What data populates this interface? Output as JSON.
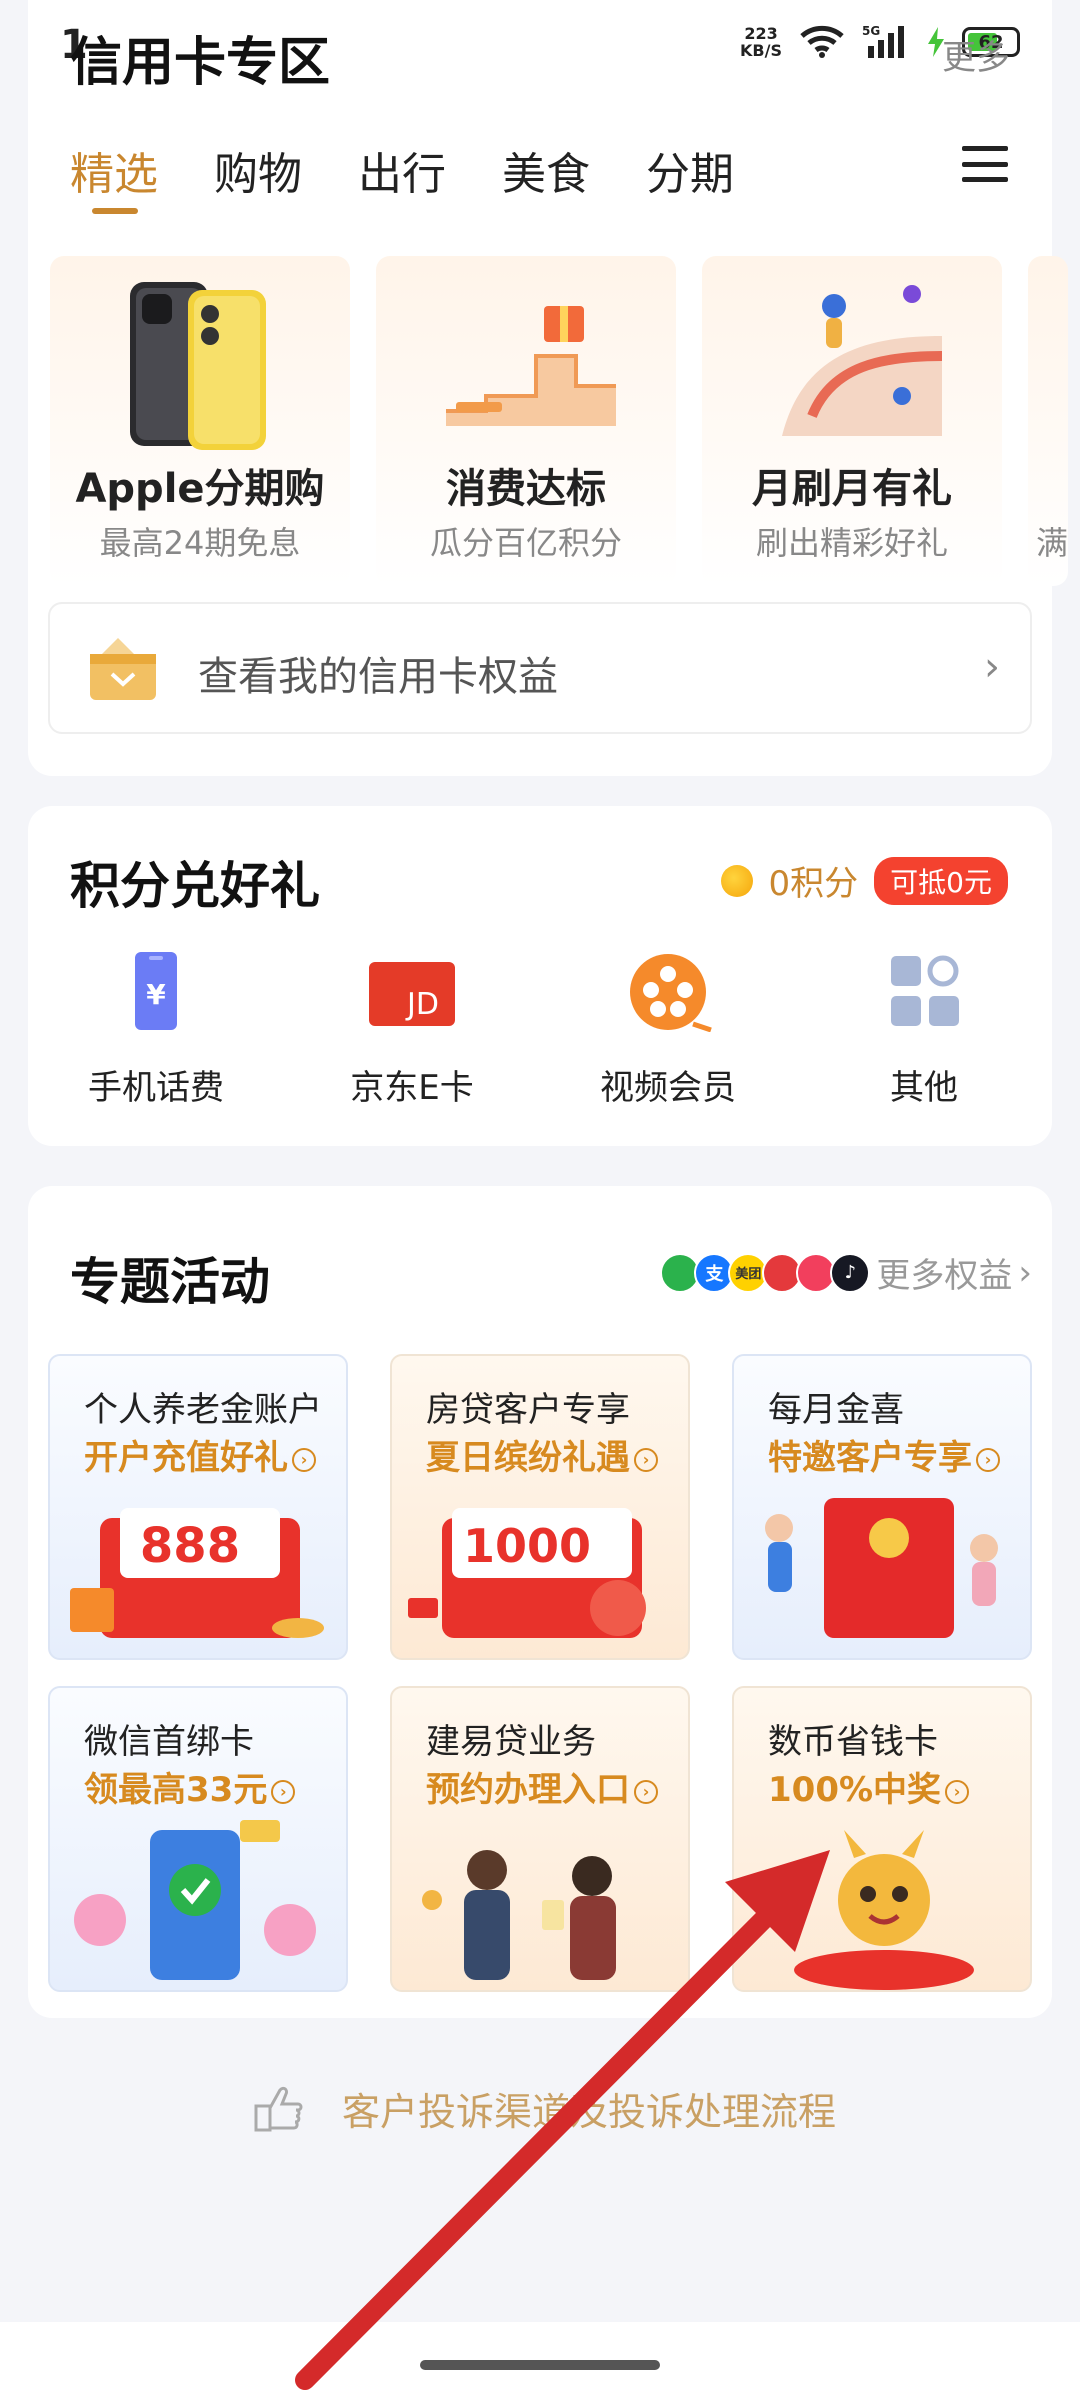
{
  "status_bar": {
    "time": "1",
    "net_speed_value": "223",
    "net_speed_unit": "KB/S",
    "signal_label": "5G",
    "battery": "62"
  },
  "header": {
    "title": "信用卡专区",
    "more": "更多"
  },
  "tabs": [
    {
      "label": "精选",
      "active": true
    },
    {
      "label": "购物",
      "active": false
    },
    {
      "label": "出行",
      "active": false
    },
    {
      "label": "美食",
      "active": false
    },
    {
      "label": "分期",
      "active": false
    }
  ],
  "promos": [
    {
      "title": "Apple分期购",
      "subtitle": "最高24期免息"
    },
    {
      "title": "消费达标",
      "subtitle": "瓜分百亿积分"
    },
    {
      "title": "月刷月有礼",
      "subtitle": "刷出精彩好礼"
    },
    {
      "title": "",
      "subtitle": "满"
    }
  ],
  "rights_bar": {
    "label": "查看我的信用卡权益"
  },
  "points": {
    "title": "积分兑好礼",
    "balance": "0积分",
    "deduct": "可抵0元",
    "items": [
      {
        "label": "手机话费",
        "icon": "phone-bill-icon"
      },
      {
        "label": "京东E卡",
        "icon": "jd-card-icon",
        "icon_text": "JD"
      },
      {
        "label": "视频会员",
        "icon": "video-reel-icon"
      },
      {
        "label": "其他",
        "icon": "grid-apps-icon"
      }
    ]
  },
  "activities": {
    "title": "专题活动",
    "more_label": "更多权益",
    "brand_icons": [
      {
        "name": "wechat-icon",
        "text": "",
        "color": "#2bb24c"
      },
      {
        "name": "alipay-icon",
        "text": "支",
        "color": "#1677ff"
      },
      {
        "name": "meituan-icon",
        "text": "美团",
        "color": "#ffd100"
      },
      {
        "name": "brand-red-icon",
        "text": "",
        "color": "#e4393c"
      },
      {
        "name": "brand-pink-icon",
        "text": "",
        "color": "#f23f5d"
      },
      {
        "name": "tiktok-icon",
        "text": "♪",
        "color": "#161823"
      }
    ],
    "tiles": [
      {
        "line1": "个人养老金账户",
        "line2": "开户充值好礼",
        "amount": "888",
        "style": "blue"
      },
      {
        "line1": "房贷客户专享",
        "line2": "夏日缤纷礼遇",
        "amount": "1000",
        "style": "warm"
      },
      {
        "line1": "每月金喜",
        "line2": "特邀客户专享",
        "amount": "",
        "style": "blue"
      },
      {
        "line1": "微信首绑卡",
        "line2": "领最高33元",
        "amount": "",
        "style": "blue"
      },
      {
        "line1": "建易贷业务",
        "line2": "预约办理入口",
        "amount": "",
        "style": "warm"
      },
      {
        "line1": "数币省钱卡",
        "line2": "100%中奖",
        "amount": "",
        "style": "warm"
      }
    ]
  },
  "complaint": {
    "label": "客户投诉渠道及投诉处理流程"
  },
  "colors": {
    "accent": "#c9872f",
    "badge_red": "#f4422f",
    "arrow": "#d42a2a"
  }
}
